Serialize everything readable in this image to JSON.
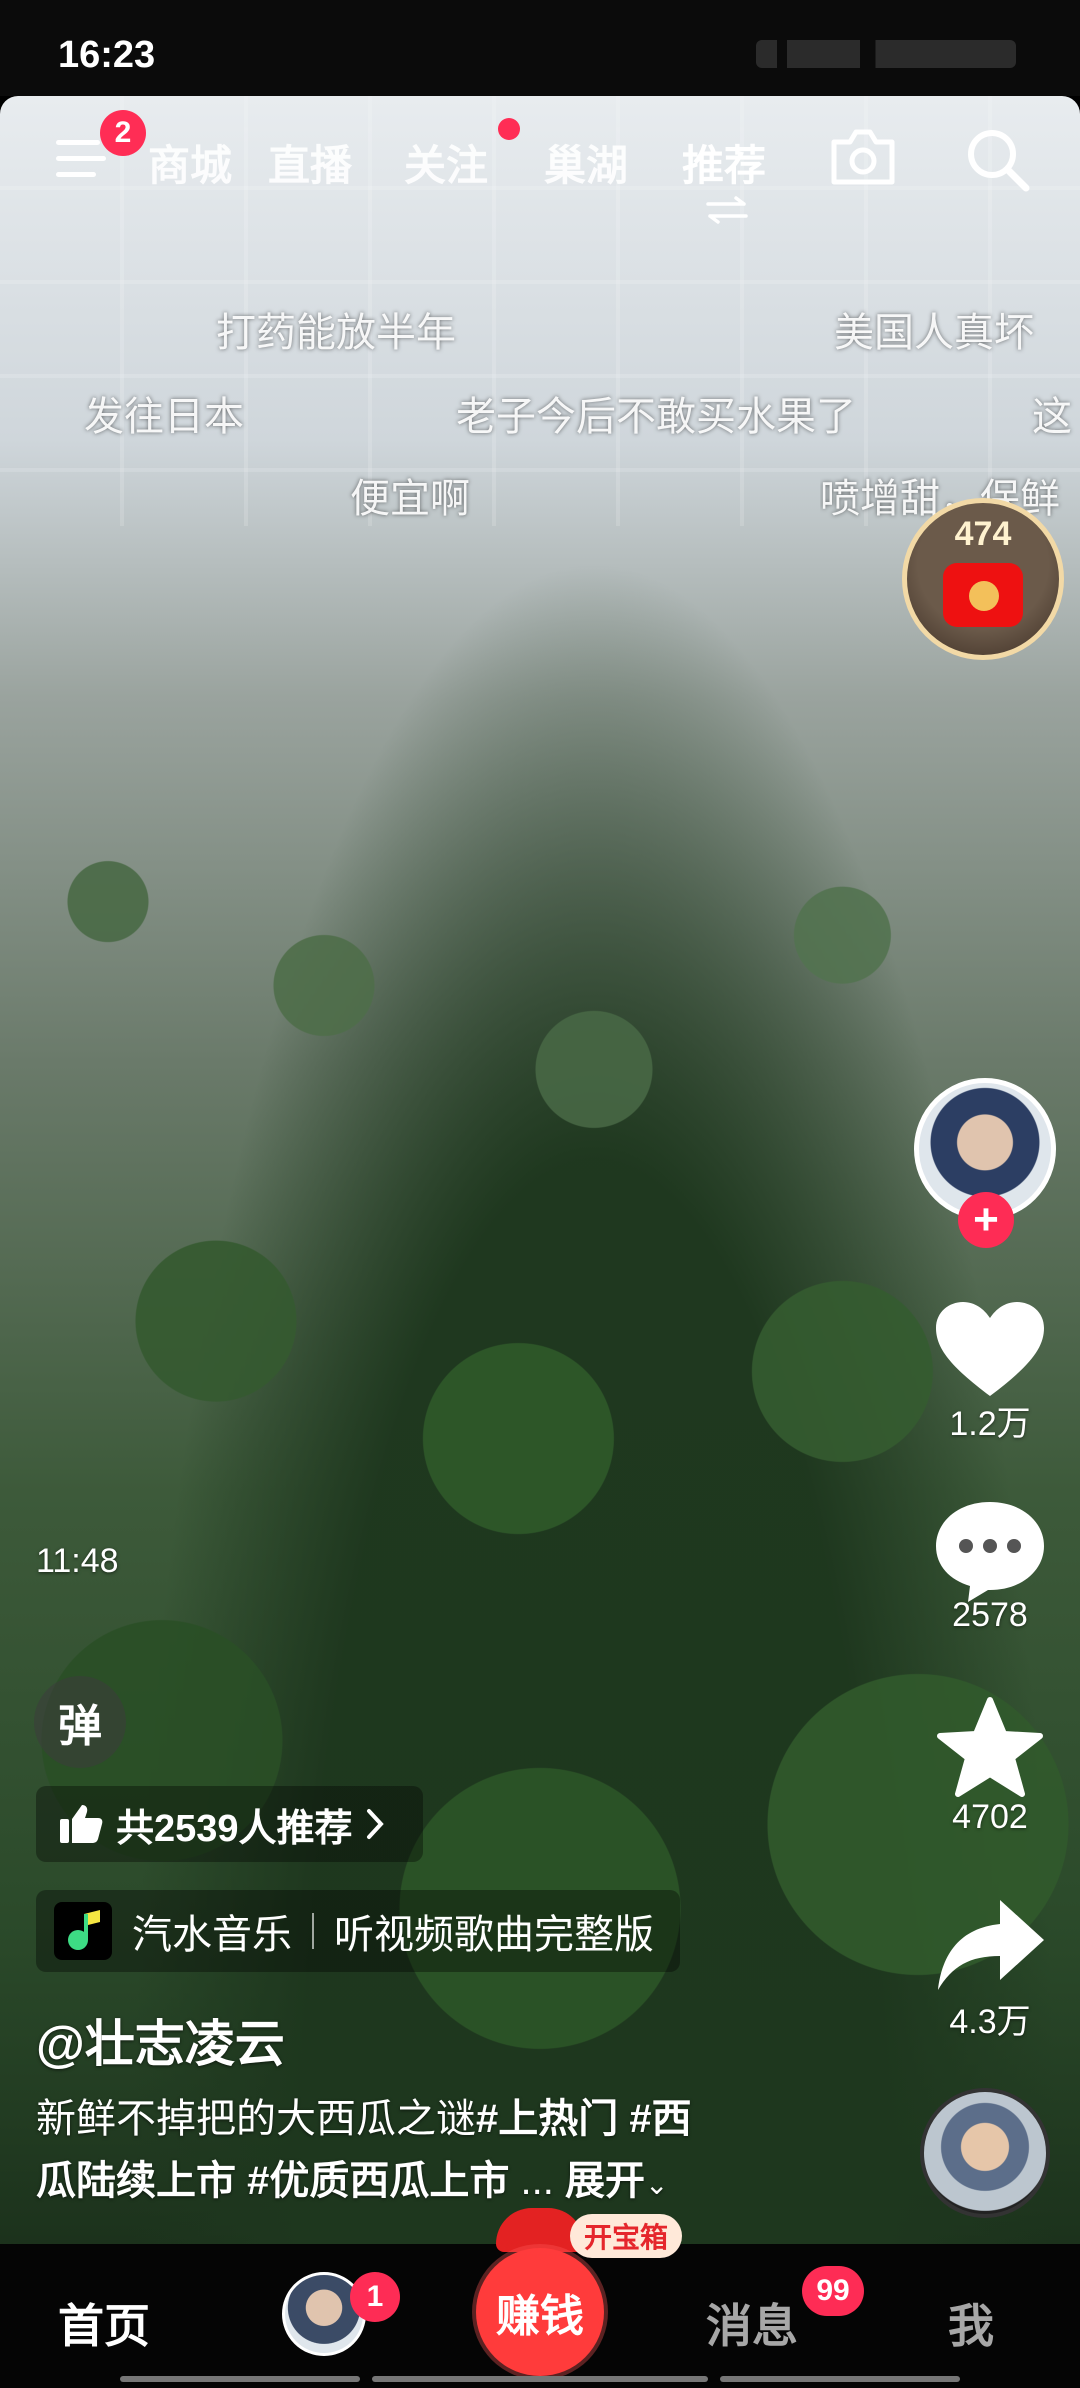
{
  "status_bar": {
    "time": "16:23"
  },
  "top_nav": {
    "menu_badge": "2",
    "tabs": [
      {
        "label": "商城"
      },
      {
        "label": "直播"
      },
      {
        "label": "关注"
      },
      {
        "label": "巢湖"
      },
      {
        "label": "推荐"
      }
    ],
    "icons": {
      "menu": "menu-icon",
      "camera": "camera-icon",
      "search": "search-icon",
      "swap": "swap-arrows-icon"
    }
  },
  "danmaku": [
    "打药能放半年",
    "美国人真坏",
    "发往日本",
    "老子今后不敢买水果了",
    "这",
    "便宜啊",
    "喷增甜，保鲜"
  ],
  "red_packet": {
    "count": "474"
  },
  "right_rail": {
    "likes": "1.2万",
    "comments": "2578",
    "favorites": "4702",
    "shares": "4.3万"
  },
  "video": {
    "timestamp": "11:48"
  },
  "bottom_info": {
    "danmaku_toggle": "弹",
    "recommend": "共2539人推荐",
    "music_source": "汽水音乐",
    "music_action": "听视频歌曲完整版",
    "author": "@壮志凌云",
    "description_line1": "新鲜不掉把的大西瓜之谜",
    "tag1": "#上热门",
    "tag2_part1": "#西",
    "tag2_part2": "瓜陆续上市",
    "tag3": "#优质西瓜上市",
    "ellipsis": "...",
    "expand": "展开"
  },
  "bottom_nav": {
    "home": "首页",
    "friends_badge": "1",
    "earn": "赚钱",
    "treasure": "开宝箱",
    "messages": "消息",
    "messages_badge": "99",
    "me": "我"
  },
  "colors": {
    "accent_red": "#fe2c55",
    "background": "#000000"
  }
}
